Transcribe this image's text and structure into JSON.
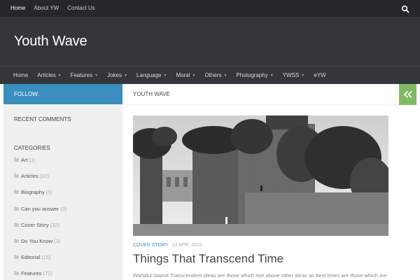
{
  "topbar": {
    "items": [
      {
        "label": "Home",
        "active": true
      },
      {
        "label": "About YW",
        "active": false
      },
      {
        "label": "Contact Us",
        "active": false
      }
    ],
    "search_icon": "search-icon"
  },
  "header": {
    "site_title": "Youth Wave"
  },
  "mainnav": {
    "items": [
      {
        "label": "Home",
        "has_dropdown": false
      },
      {
        "label": "Articles",
        "has_dropdown": true
      },
      {
        "label": "Features",
        "has_dropdown": true
      },
      {
        "label": "Jokes",
        "has_dropdown": true
      },
      {
        "label": "Language",
        "has_dropdown": true
      },
      {
        "label": "Moral",
        "has_dropdown": true
      },
      {
        "label": "Others",
        "has_dropdown": true
      },
      {
        "label": "Photography",
        "has_dropdown": true
      },
      {
        "label": "YWSS",
        "has_dropdown": true
      },
      {
        "label": "eYW",
        "has_dropdown": false
      }
    ]
  },
  "sidebar": {
    "follow_label": "FOLLOW:",
    "recent_comments_title": "RECENT COMMENTS",
    "categories_title": "CATEGORIES",
    "categories": [
      {
        "name": "Art",
        "count": "(1)"
      },
      {
        "name": "Articles",
        "count": "(62)"
      },
      {
        "name": "Biography",
        "count": "(5)"
      },
      {
        "name": "Can you answer",
        "count": "(3)"
      },
      {
        "name": "Cover Story",
        "count": "(32)"
      },
      {
        "name": "Do You Know",
        "count": "(3)"
      },
      {
        "name": "Editorial",
        "count": "(15)"
      },
      {
        "name": "Features",
        "count": "(72)"
      }
    ]
  },
  "content": {
    "breadcrumb": "YOUTH WAVE",
    "post": {
      "category": "COVER STORY",
      "date": "13 APR, 2015",
      "title": "Things That Transcend Time",
      "excerpt": "Wahidul Islam# Transcendent ideas are those which rise above other ideas as best times are those which are"
    }
  },
  "colors": {
    "topbar": "#26272b",
    "header": "#33363b",
    "follow": "#3b8dbd",
    "toggle": "#82b965",
    "accent": "#3b8dbd"
  }
}
